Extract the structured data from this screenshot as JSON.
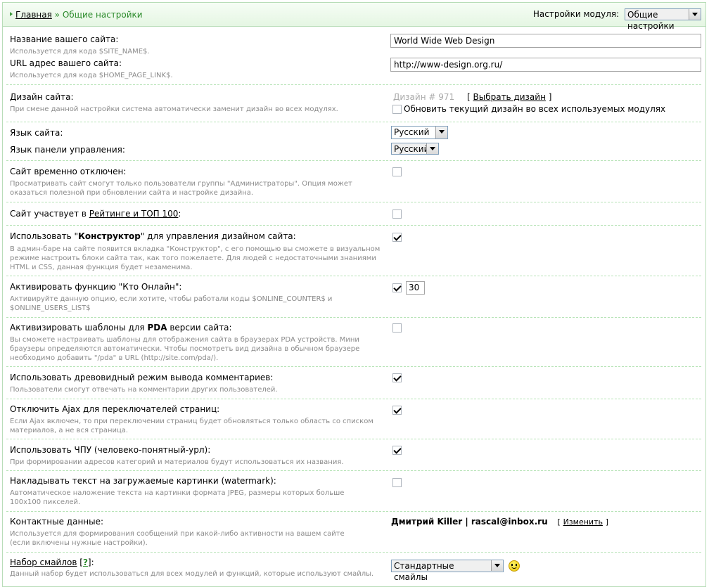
{
  "breadcrumb": {
    "home": "Главная",
    "separator": "»",
    "current": "Общие настройки"
  },
  "module_settings": {
    "label": "Настройки модуля:",
    "selected": "Общие настройки"
  },
  "site_name": {
    "label": "Название вашего сайта:",
    "desc": "Используется для кода $SITE_NAME$.",
    "value": "World Wide Web Design"
  },
  "site_url": {
    "label": "URL адрес вашего сайта:",
    "desc": "Используется для кода $HOME_PAGE_LINK$.",
    "value": "http://www-design.org.ru/"
  },
  "design": {
    "label": "Дизайн сайта:",
    "desc": "При смене данной настройки система автоматически заменит дизайн во всех модулях.",
    "current": "Дизайн # 971",
    "choose_open": "[",
    "choose_link": "Выбрать дизайн",
    "choose_close": "]",
    "update_all": "Обновить текущий дизайн во всех используемых модулях",
    "update_all_checked": false
  },
  "language": {
    "label": "Язык сайта:",
    "value": "Русский"
  },
  "panel_language": {
    "label": "Язык панели управления:",
    "value": "Русский"
  },
  "disabled": {
    "label": "Сайт временно отключен:",
    "desc": "Просматривать сайт смогут только пользователи группы \"Администраторы\". Опция может оказаться полезной при обновлении сайта и настройке дизайна.",
    "checked": false
  },
  "rating": {
    "label_prefix": "Сайт участвует в ",
    "label_link": "Рейтинге и ТОП 100",
    "label_suffix": ":",
    "checked": false
  },
  "constructor": {
    "label_prefix": "Использовать \"",
    "label_bold": "Конструктор",
    "label_suffix": "\" для управления дизайном сайта:",
    "desc": "В админ-баре на сайте появится вкладка \"Конструктор\", с его помощью вы сможете в визуальном режиме настроить блоки сайта так, как того пожелаете. Для людей с недостаточными знаниями HTML и CSS, данная функция будет незаменима.",
    "checked": true
  },
  "who_online": {
    "label": "Активировать функцию \"Кто Онлайн\":",
    "desc": "Активируйте данную опцию, если хотите, чтобы работали коды $ONLINE_COUNTER$ и $ONLINE_USERS_LIST$",
    "checked": true,
    "value": "30"
  },
  "pda": {
    "label_prefix": "Активизировать шаблоны для ",
    "label_bold": "PDA",
    "label_suffix": " версии сайта:",
    "desc": "Вы сможете настраивать шаблоны для отображения сайта в браузерах PDA устройств. Мини браузеры определяются автоматически. Чтобы посмотреть вид дизайна в обычном браузере необходимо добавить \"/pda\" в URL (http://site.com/pda/).",
    "checked": false
  },
  "tree_comments": {
    "label": "Использовать древовидный режим вывода комментариев:",
    "desc": "Пользователи смогут отвечать на комментарии других пользователей.",
    "checked": true
  },
  "ajax": {
    "label": "Отключить Ajax для переключателей страниц:",
    "desc": "Если Ajax включен, то при переключении страниц будет обновляться только область со списком материалов, а не вся страница.",
    "checked": true
  },
  "cpu": {
    "label": "Использовать ЧПУ (человеко-понятный-урл):",
    "desc": "При формировании адресов категорий и материалов будут использоваться их названия.",
    "checked": true
  },
  "watermark": {
    "label": "Накладывать текст на загружаемые картинки (watermark):",
    "desc": "Автоматическое наложение текста на картинки формата JPEG, размеры которых больше 100x100 пикселей.",
    "checked": false
  },
  "contacts": {
    "label": "Контактные данные:",
    "desc": "Используется для формирования сообщений при какой-либо активности на вашем сайте (если включены нужные настройки).",
    "value": "Дмитрий Killer | rascal@inbox.ru",
    "change_open": "[",
    "change_link": "Изменить",
    "change_close": "]"
  },
  "smiles": {
    "label_link": "Набор смайлов",
    "help_open": "[",
    "help_link": "?",
    "help_close": "]:",
    "desc": "Данный набор будет использоваться для всех модулей и функций, которые используют смайлы.",
    "value": "Стандартные смайлы",
    "icon": "smiley-icon"
  }
}
